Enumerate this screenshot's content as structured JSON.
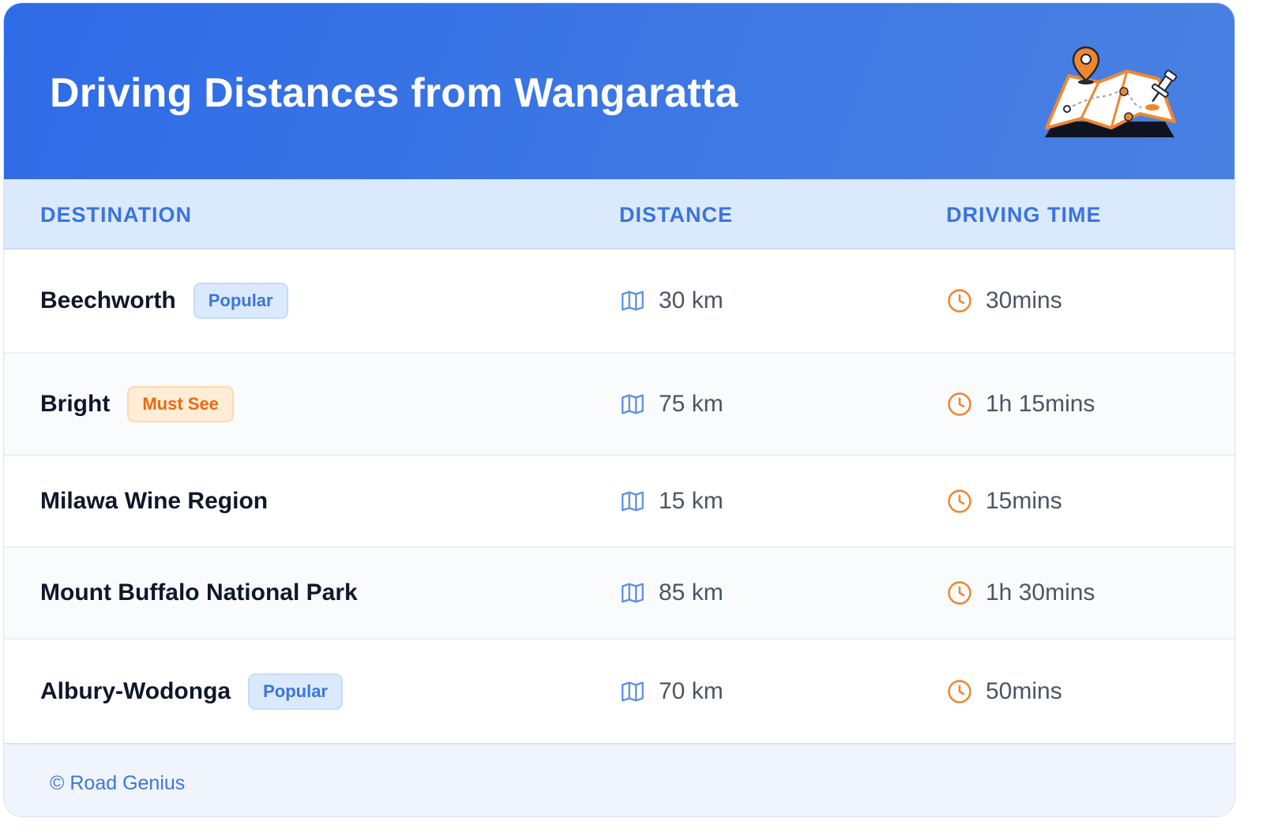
{
  "header": {
    "title": "Driving Distances from Wangaratta",
    "illustration": "map-with-pins-icon"
  },
  "table": {
    "columns": [
      "DESTINATION",
      "DISTANCE",
      "DRIVING TIME"
    ],
    "rows": [
      {
        "destination": "Beechworth",
        "badge": "Popular",
        "badge_color": "#3b76dc",
        "distance": "30 km",
        "time": "30mins"
      },
      {
        "destination": "Bright",
        "badge": "Must See",
        "badge_color": "#ea6a13",
        "distance": "75 km",
        "time": "1h 15mins"
      },
      {
        "destination": "Milawa Wine Region",
        "badge": "",
        "distance": "15 km",
        "time": "15mins"
      },
      {
        "destination": "Mount Buffalo National Park",
        "badge": "",
        "distance": "85 km",
        "time": "1h 30mins"
      },
      {
        "destination": "Albury-Wodonga",
        "badge": "Popular",
        "badge_color": "#3b76dc",
        "distance": "70 km",
        "time": "50mins"
      }
    ]
  },
  "icons": {
    "distance": "map-icon",
    "time": "clock-icon"
  },
  "colors": {
    "header_gradient_start": "#2e6be6",
    "header_gradient_end": "#4a80e2",
    "accent_blue": "#3a74dd",
    "accent_orange": "#f0862f",
    "header_row_bg": "#dbe9fd"
  },
  "footer": {
    "credit": "© Road Genius"
  }
}
